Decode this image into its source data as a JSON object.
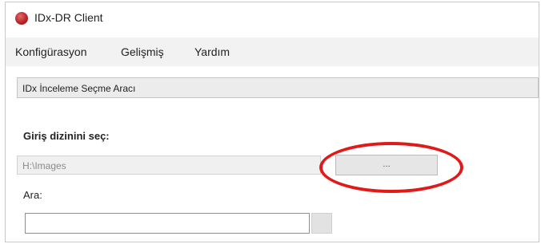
{
  "window": {
    "title": "IDx-DR Client",
    "icon": "red-circle-app-icon"
  },
  "menu": {
    "items": [
      "Konfigürasyon",
      "Gelişmiş",
      "Yardım"
    ]
  },
  "tool_header": {
    "title": "IDx İnceleme Seçme Aracı"
  },
  "form": {
    "input_dir_label": "Giriş dizinini seç:",
    "input_dir_value": "H:\\Images",
    "browse_label": "...",
    "search_label": "Ara:",
    "search_value": ""
  },
  "colors": {
    "highlight": "#e01a1a",
    "app_icon": "#b9262a"
  }
}
